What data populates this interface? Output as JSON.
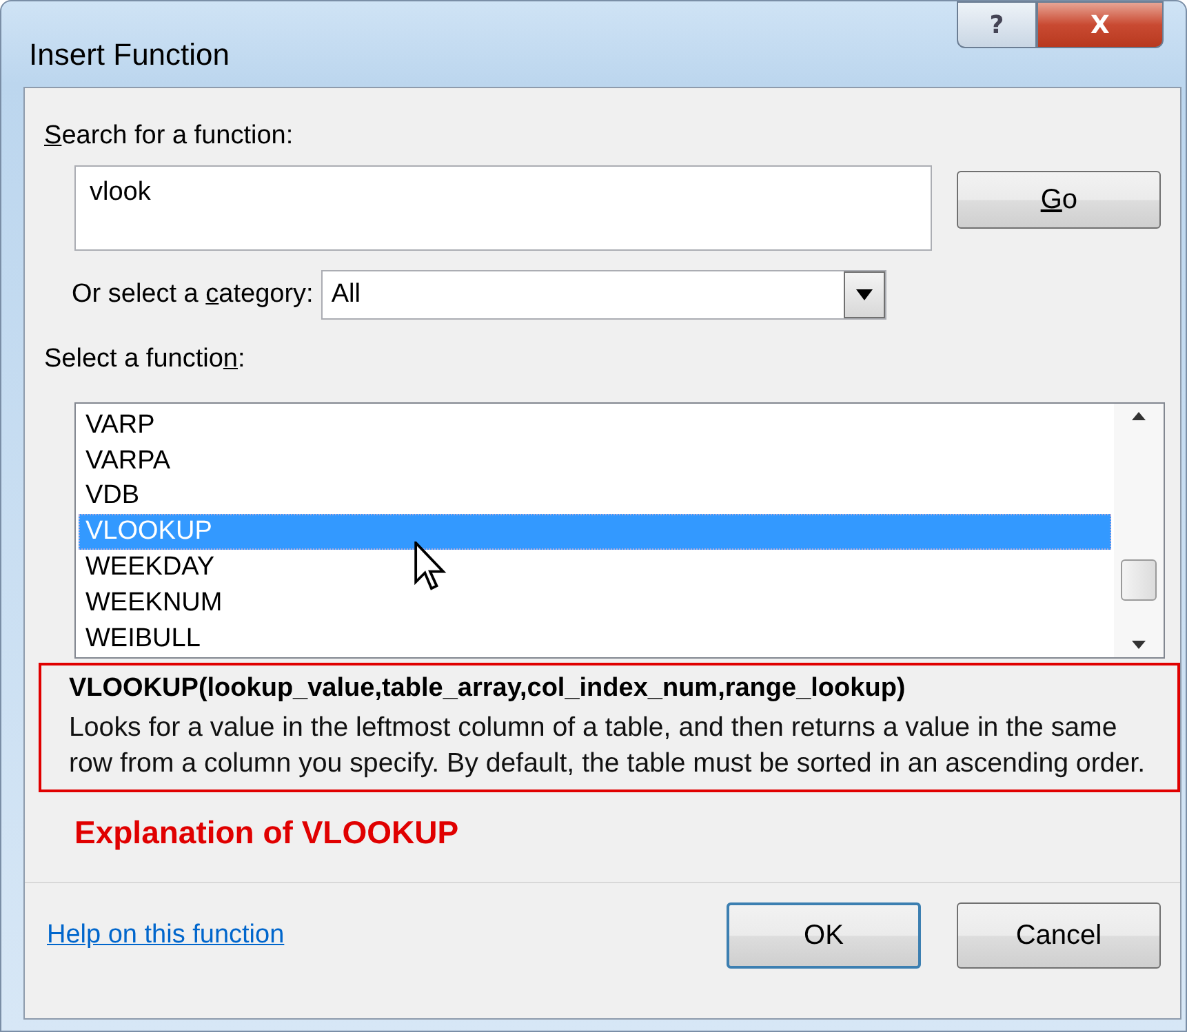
{
  "window": {
    "title": "Insert Function",
    "help_button": "?",
    "close_button": "X"
  },
  "search": {
    "label": {
      "mnemonic": "S",
      "after": "earch for a function:"
    },
    "value": "vlook",
    "go_button": {
      "mnemonic": "G",
      "after": "o"
    }
  },
  "category": {
    "label": {
      "before": "Or select a ",
      "mnemonic": "c",
      "after": "ategory:"
    },
    "value": "All"
  },
  "function_list": {
    "label": {
      "before": "Select a functio",
      "mnemonic": "n",
      "after": ":"
    },
    "items": [
      {
        "name": "VARP",
        "selected": false
      },
      {
        "name": "VARPA",
        "selected": false
      },
      {
        "name": "VDB",
        "selected": false
      },
      {
        "name": "VLOOKUP",
        "selected": true
      },
      {
        "name": "WEEKDAY",
        "selected": false
      },
      {
        "name": "WEEKNUM",
        "selected": false
      },
      {
        "name": "WEIBULL",
        "selected": false
      }
    ]
  },
  "description": {
    "signature": "VLOOKUP(lookup_value,table_array,col_index_num,range_lookup)",
    "text": "Looks for a value in the leftmost column of a table, and then returns a value in the same row from a column you specify. By default, the table must be sorted in an ascending order."
  },
  "annotation": "Explanation of VLOOKUP",
  "help_link": "Help on this function",
  "buttons": [
    {
      "label": "OK",
      "kind": "default"
    },
    {
      "label": "Cancel",
      "kind": "normal"
    }
  ]
}
